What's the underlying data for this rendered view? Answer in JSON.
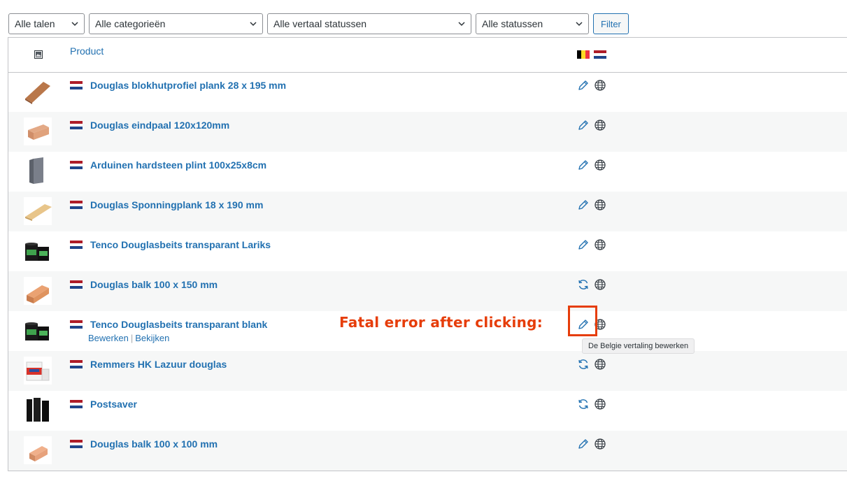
{
  "filters": {
    "languages": {
      "value": "Alle talen"
    },
    "categories": {
      "value": "Alle categorieën"
    },
    "translation_status": {
      "value": "Alle vertaal statussen"
    },
    "status": {
      "value": "Alle statussen"
    },
    "filter_button": "Filter"
  },
  "table": {
    "col_image_icon": "image-icon",
    "col_product": "Product",
    "col_flags": [
      "flag-belgium",
      "flag-netherlands"
    ]
  },
  "rows": [
    {
      "name": "Douglas blokhutprofiel plank 28 x 195 mm",
      "thumb": "wood-plank",
      "status_icon": "pencil-icon"
    },
    {
      "name": "Douglas eindpaal 120x120mm",
      "thumb": "wood-post",
      "status_icon": "pencil-icon"
    },
    {
      "name": "Arduinen hardsteen plint 100x25x8cm",
      "thumb": "stone-plinth",
      "status_icon": "pencil-icon"
    },
    {
      "name": "Douglas Sponningplank 18 x 190 mm",
      "thumb": "wood-plank-light",
      "status_icon": "pencil-icon"
    },
    {
      "name": "Tenco Douglasbeits transparant Lariks",
      "thumb": "paint-cans",
      "status_icon": "pencil-icon"
    },
    {
      "name": "Douglas balk 100 x 150 mm",
      "thumb": "wood-beam",
      "status_icon": "refresh-icon"
    },
    {
      "name": "Tenco Douglasbeits transparant blank",
      "thumb": "paint-cans",
      "status_icon": "pencil-icon"
    },
    {
      "name": "Remmers HK Lazuur douglas",
      "thumb": "paint-bucket",
      "status_icon": "refresh-icon"
    },
    {
      "name": "Postsaver",
      "thumb": "black-sleeves",
      "status_icon": "refresh-icon"
    },
    {
      "name": "Douglas balk 100 x 100 mm",
      "thumb": "wood-beam-small",
      "status_icon": "pencil-icon"
    }
  ],
  "row_actions": {
    "edit": "Bewerken",
    "separator": "|",
    "view": "Bekijken"
  },
  "annotation": "Fatal error after clicking:",
  "tooltip": "De Belgie vertaling bewerken",
  "colors": {
    "link": "#2271b1",
    "annotation": "#e63d0a",
    "row_alt": "#f6f7f7"
  }
}
